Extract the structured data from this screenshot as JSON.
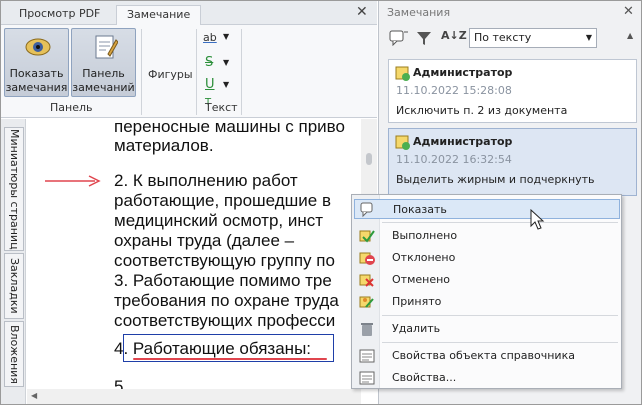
{
  "ribbon": {
    "tabs": [
      {
        "label": "Просмотр PDF",
        "active": false
      },
      {
        "label": "Замечание",
        "active": true
      }
    ],
    "close_glyph": "✕",
    "buttons": {
      "show_notes": "Показать замечания",
      "notes_panel": "Панель замечаний"
    },
    "groups": {
      "panel": "Панель",
      "shapes": "Фигуры",
      "text": "Текст"
    },
    "text_tools": [
      "ab",
      "S",
      "U",
      "T"
    ]
  },
  "side_tabs": [
    "Миниатюры страниц",
    "Закладки",
    "Вложения"
  ],
  "document": {
    "lines": [
      "переносные машины с приво",
      "материалов.",
      "2. К    выполнению    работ",
      "работающие, прошедшие в",
      "медицинский осмотр, инст",
      "охраны труда (далее –",
      "соответствующую группу по",
      "3. Работающие помимо тре",
      "требования по охране труда",
      "соответствующих професси",
      "4. Работающие обязаны:",
      "5                ,"
    ]
  },
  "panel": {
    "title": "Замечания",
    "sort_value": "По тексту",
    "notes": [
      {
        "author": "Администратор",
        "date": "11.10.2022 15:28:08",
        "text": "Исключить п. 2 из документа",
        "selected": false
      },
      {
        "author": "Администратор",
        "date": "11.10.2022 16:32:54",
        "text": "Выделить жирным и подчеркнуть",
        "selected": true
      }
    ]
  },
  "context_menu": {
    "items": [
      {
        "label": "Показать",
        "icon": "show-icon",
        "highlighted": true
      },
      {
        "label": "Выполнено",
        "icon": "check-icon"
      },
      {
        "label": "Отклонено",
        "icon": "reject-icon"
      },
      {
        "label": "Отменено",
        "icon": "cancel-icon"
      },
      {
        "label": "Принято",
        "icon": "accept-icon"
      },
      {
        "label": "Удалить",
        "icon": "trash-icon"
      },
      {
        "label": "Свойства объекта справочника",
        "icon": "properties-icon"
      },
      {
        "label": "Свойства...",
        "icon": "properties-icon"
      }
    ]
  },
  "colors": {
    "accent": "#3a6fc2",
    "arrow": "#e0454e",
    "underline": "#e0454e",
    "box": "#1f3fa8",
    "highlight": "#dbe8f7"
  }
}
